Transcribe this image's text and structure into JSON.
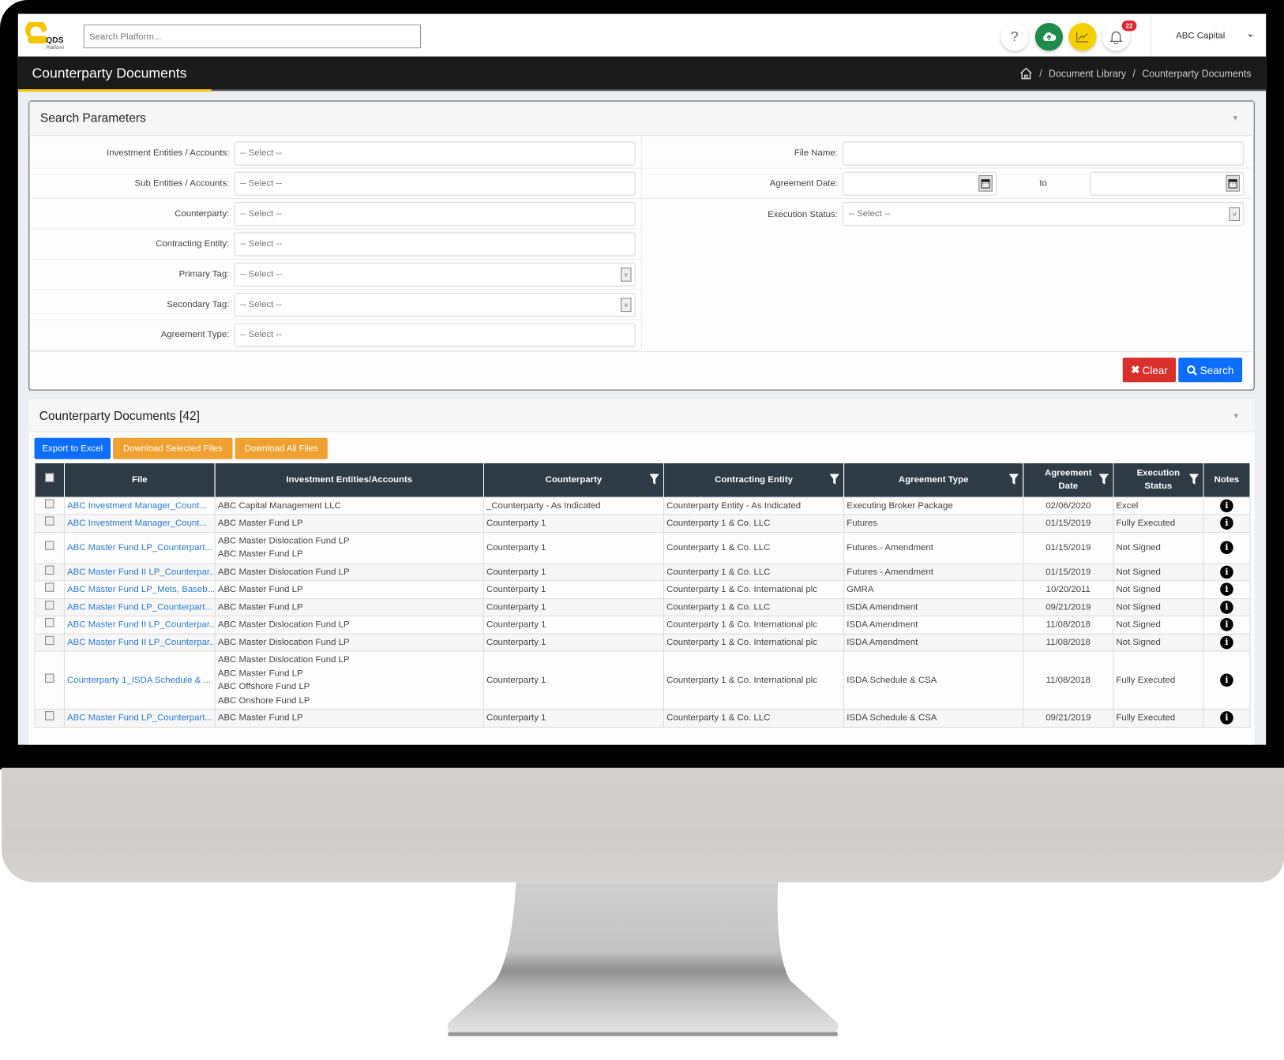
{
  "app": {
    "logo_text": "QDS",
    "logo_sub": "Platform",
    "search_placeholder": "Search Platform...",
    "user": "ABC Capital",
    "notification_count": "22",
    "colors": {
      "accent": "#f5c400",
      "upload": "#1e8a4c",
      "chart": "#f5d000",
      "primary": "#0d6efd",
      "danger": "#d9302c",
      "warning": "#f0a030",
      "header": "#2e3a44"
    }
  },
  "header": {
    "title": "Counterparty Documents",
    "breadcrumb": [
      "Document Library",
      "Counterparty Documents"
    ],
    "sep": "/"
  },
  "search": {
    "title": "Search Parameters",
    "left": [
      {
        "label": "Investment Entities / Accounts:",
        "value": "-- Select --",
        "dropdown": false
      },
      {
        "label": "Sub Entities / Accounts:",
        "value": "-- Select --",
        "dropdown": false
      },
      {
        "label": "Counterparty:",
        "value": "-- Select --",
        "dropdown": false
      },
      {
        "label": "Contracting Entity:",
        "value": "-- Select --",
        "dropdown": false
      },
      {
        "label": "Primary Tag:",
        "value": "-- Select --",
        "dropdown": true
      },
      {
        "label": "Secondary Tag:",
        "value": "-- Select --",
        "dropdown": true
      },
      {
        "label": "Agreement Type:",
        "value": "-- Select --",
        "dropdown": false
      }
    ],
    "file_name_label": "File Name:",
    "file_name_value": "",
    "agreement_date_label": "Agreement Date:",
    "to_label": "to",
    "execution_status_label": "Execution Status:",
    "execution_status_value": "-- Select --",
    "clear_label": "Clear",
    "search_label": "Search"
  },
  "documents": {
    "title": "Counterparty Documents [42]",
    "export_label": "Export to Excel",
    "download_selected_label": "Download Selected Files",
    "download_all_label": "Download All Files",
    "columns": [
      "File",
      "Investment Entities/Accounts",
      "Counterparty",
      "Contracting Entity",
      "Agreement Type",
      "Agreement Date",
      "Execution Status",
      "Notes"
    ],
    "rows": [
      {
        "file": "ABC Investment Manager_Count...",
        "entities": [
          "ABC Capital Management LLC"
        ],
        "counterparty": "_Counterparty - As Indicated",
        "contracting": "Counterparty Entity - As Indicated",
        "type": "Executing Broker Package",
        "date": "02/06/2020",
        "status": "Excel"
      },
      {
        "file": "ABC Investment Manager_Count...",
        "entities": [
          "ABC Master Fund LP"
        ],
        "counterparty": "Counterparty 1",
        "contracting": "Counterparty 1 & Co. LLC",
        "type": "Futures",
        "date": "01/15/2019",
        "status": "Fully Executed"
      },
      {
        "file": "ABC Master Fund LP_Counterpart...",
        "entities": [
          "ABC Master Dislocation Fund LP",
          "ABC Master Fund LP"
        ],
        "counterparty": "Counterparty 1",
        "contracting": "Counterparty 1 & Co. LLC",
        "type": "Futures - Amendment",
        "date": "01/15/2019",
        "status": "Not Signed"
      },
      {
        "file": "ABC Master Fund II LP_Counterpar...",
        "entities": [
          "ABC Master Dislocation Fund LP"
        ],
        "counterparty": "Counterparty 1",
        "contracting": "Counterparty 1 & Co. LLC",
        "type": "Futures - Amendment",
        "date": "01/15/2019",
        "status": "Not Signed"
      },
      {
        "file": "ABC Master Fund LP_Mets, Baseb...",
        "entities": [
          "ABC Master Fund LP"
        ],
        "counterparty": "Counterparty 1",
        "contracting": "Counterparty 1 & Co. International plc",
        "type": "GMRA",
        "date": "10/20/2011",
        "status": "Not Signed"
      },
      {
        "file": "ABC Master Fund LP_Counterpart...",
        "entities": [
          "ABC Master Fund LP"
        ],
        "counterparty": "Counterparty 1",
        "contracting": "Counterparty 1 & Co. LLC",
        "type": "ISDA Amendment",
        "date": "09/21/2019",
        "status": "Not Signed"
      },
      {
        "file": "ABC Master Fund II LP_Counterpar...",
        "entities": [
          "ABC Master Dislocation Fund LP"
        ],
        "counterparty": "Counterparty 1",
        "contracting": "Counterparty 1 & Co. International plc",
        "type": "ISDA Amendment",
        "date": "11/08/2018",
        "status": "Not Signed"
      },
      {
        "file": "ABC Master Fund II LP_Counterpar...",
        "entities": [
          "ABC Master Dislocation Fund LP"
        ],
        "counterparty": "Counterparty 1",
        "contracting": "Counterparty 1 & Co. International plc",
        "type": "ISDA Amendment",
        "date": "11/08/2018",
        "status": "Not Signed"
      },
      {
        "file": "Counterparty 1_ISDA Schedule & ...",
        "entities": [
          "ABC Master Dislocation Fund LP",
          "ABC Master Fund LP",
          "ABC Offshore Fund LP",
          "ABC Onshore Fund LP"
        ],
        "counterparty": "Counterparty 1",
        "contracting": "Counterparty 1 & Co. International plc",
        "type": "ISDA Schedule & CSA",
        "date": "11/08/2018",
        "status": "Fully Executed"
      },
      {
        "file": "ABC Master Fund LP_Counterpart...",
        "entities": [
          "ABC Master Fund LP"
        ],
        "counterparty": "Counterparty 1",
        "contracting": "Counterparty 1 & Co. LLC",
        "type": "ISDA Schedule & CSA",
        "date": "09/21/2019",
        "status": "Fully Executed"
      }
    ]
  }
}
